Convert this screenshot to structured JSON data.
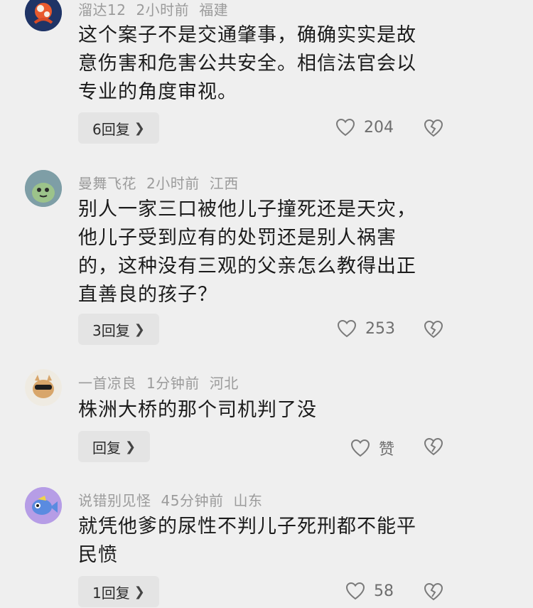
{
  "comments": [
    {
      "username": "溜达12",
      "time": "2小时前",
      "location": "福建",
      "lines": [
        "这个案子不是交通肇事，确确实实是故",
        "意伤害和危害公共安全。相信法官会以",
        "专业的角度审视。"
      ],
      "reply_label": "6回复",
      "likes": "204"
    },
    {
      "username": "曼舞飞花",
      "time": "2小时前",
      "location": "江西",
      "lines": [
        "别人一家三口被他儿子撞死还是天灾，",
        "他儿子受到应有的处罚还是别人祸害",
        "的，这种没有三观的父亲怎么教得出正",
        "直善良的孩子？"
      ],
      "reply_label": "3回复",
      "likes": "253"
    },
    {
      "username": "一首凉良",
      "time": "1分钟前",
      "location": "河北",
      "lines": [
        "株洲大桥的那个司机判了没"
      ],
      "reply_label": "回复",
      "likes": "赞"
    },
    {
      "username": "说错别见怪",
      "time": "45分钟前",
      "location": "山东",
      "lines": [
        "就凭他爹的尿性不判儿子死刑都不能平",
        "民愤"
      ],
      "reply_label": "1回复",
      "likes": "58"
    }
  ],
  "icons": {
    "like": "heart-outline-icon",
    "dislike": "broken-heart-icon",
    "reply_arrow": "chevron-right-icon"
  }
}
